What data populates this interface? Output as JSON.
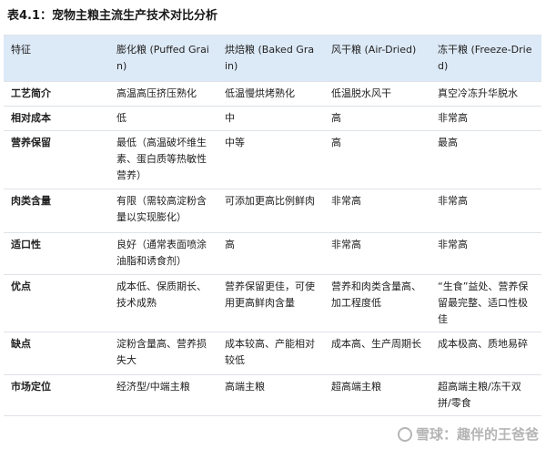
{
  "title": "表4.1：宠物主粮主流生产技术对比分析",
  "headers": [
    "特征",
    "膨化粮 (Puffed Grain)",
    "烘焙粮 (Baked Grain)",
    "风干粮 (Air-Dried)",
    "冻干粮 (Freeze-Dried)"
  ],
  "rows": [
    [
      "工艺简介",
      "高温高压挤压熟化",
      "低温慢烘烤熟化",
      "低温脱水风干",
      "真空冷冻升华脱水"
    ],
    [
      "相对成本",
      "低",
      "中",
      "高",
      "非常高"
    ],
    [
      "营养保留",
      "最低（高温破坏维生素、蛋白质等热敏性营养）",
      "中等",
      "高",
      "最高"
    ],
    [
      "肉类含量",
      "有限（需较高淀粉含量以实现膨化）",
      "可添加更高比例鲜肉",
      "非常高",
      "非常高"
    ],
    [
      "适口性",
      "良好（通常表面喷涂油脂和诱食剂）",
      "高",
      "非常高",
      "非常高"
    ],
    [
      "优点",
      "成本低、保质期长、技术成熟",
      "营养保留更佳，可使用更高鲜肉含量",
      "营养和肉类含量高、加工程度低",
      "“生食”益处、营养保留最完整、适口性极佳"
    ],
    [
      "缺点",
      "淀粉含量高、营养损失大",
      "成本较高、产能相对较低",
      "成本高、生产周期长",
      "成本极高、质地易碎"
    ],
    [
      "市场定位",
      "经济型/中端主粮",
      "高端主粮",
      "超高端主粮",
      "超高端主粮/冻干双拼/零食"
    ]
  ],
  "watermark": "雪球：趣伴的王爸爸"
}
